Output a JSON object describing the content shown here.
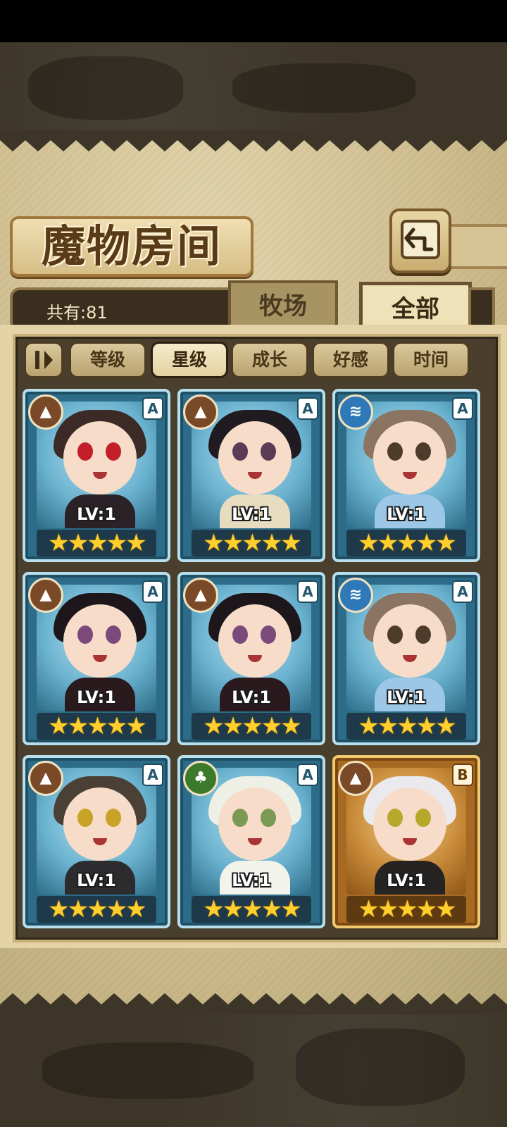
{
  "header": {
    "title": "魔物房间",
    "back_icon": "back-arrow-icon"
  },
  "summary": {
    "count_label": "共有:81"
  },
  "tabs": [
    {
      "label": "牧场",
      "selected": false
    },
    {
      "label": "全部",
      "selected": true
    }
  ],
  "sort": {
    "toggle_icon": "sort-order-icon",
    "buttons": [
      {
        "label": "等级",
        "active": false
      },
      {
        "label": "星级",
        "active": true
      },
      {
        "label": "成长",
        "active": false
      },
      {
        "label": "好感",
        "active": false
      },
      {
        "label": "时间",
        "active": false
      }
    ]
  },
  "monsters": [
    {
      "element": "earth",
      "element_icon": "mountain-element-icon",
      "grade": "A",
      "level": "LV:1",
      "stars": "★★★★★",
      "frame": "blue",
      "hair": "#3b2a26",
      "body": "#2a2226",
      "eye": "#c21f2a"
    },
    {
      "element": "earth",
      "element_icon": "mountain-element-icon",
      "grade": "A",
      "level": "LV:1",
      "stars": "★★★★★",
      "frame": "blue",
      "hair": "#1f1b20",
      "body": "#e8dcc0",
      "eye": "#5a3c55"
    },
    {
      "element": "water",
      "element_icon": "water-element-icon",
      "grade": "A",
      "level": "LV:1",
      "stars": "★★★★★",
      "frame": "blue",
      "hair": "#8c7462",
      "body": "#9cc7e6",
      "eye": "#4e3c2a"
    },
    {
      "element": "earth",
      "element_icon": "mountain-element-icon",
      "grade": "A",
      "level": "LV:1",
      "stars": "★★★★★",
      "frame": "blue",
      "hair": "#1d171c",
      "body": "#2a1a1e",
      "eye": "#7c4a7a"
    },
    {
      "element": "earth",
      "element_icon": "mountain-element-icon",
      "grade": "A",
      "level": "LV:1",
      "stars": "★★★★★",
      "frame": "blue",
      "hair": "#1d171c",
      "body": "#2a1a1e",
      "eye": "#7c4a7a"
    },
    {
      "element": "water",
      "element_icon": "water-element-icon",
      "grade": "A",
      "level": "LV:1",
      "stars": "★★★★★",
      "frame": "blue",
      "hair": "#8c7462",
      "body": "#9cc7e6",
      "eye": "#4e3c2a"
    },
    {
      "element": "earth",
      "element_icon": "mountain-element-icon",
      "grade": "A",
      "level": "LV:1",
      "stars": "★★★★★",
      "frame": "blue",
      "hair": "#4a4036",
      "body": "#2c2c2e",
      "eye": "#c9a228"
    },
    {
      "element": "wood",
      "element_icon": "leaf-element-icon",
      "grade": "A",
      "level": "LV:1",
      "stars": "★★★★★",
      "frame": "blue",
      "hair": "#eef0e6",
      "body": "#f2f4ec",
      "eye": "#7a9a54"
    },
    {
      "element": "earth",
      "element_icon": "mountain-element-icon",
      "grade": "B",
      "level": "LV:1",
      "stars": "★★★★★",
      "frame": "gold",
      "hair": "#e9e9ee",
      "body": "#262422",
      "eye": "#b6a82a"
    }
  ],
  "colors": {
    "frame_blue": "#2d6c88",
    "frame_gold": "#a86a22",
    "star": "#ffcf2e",
    "panel": "#cdbb8c"
  }
}
